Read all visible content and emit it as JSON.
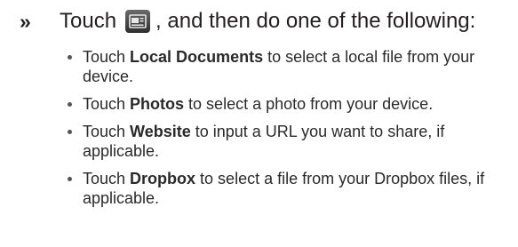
{
  "marker": "»",
  "instruction": {
    "before_icon": "Touch",
    "icon": "attach-file-icon",
    "after_icon": ", and then do one of the following:"
  },
  "options": [
    {
      "prefix": "Touch ",
      "bold": "Local Documents",
      "suffix": " to select a local file from your device."
    },
    {
      "prefix": "Touch ",
      "bold": "Photos",
      "suffix": " to select a photo from your device."
    },
    {
      "prefix": "Touch ",
      "bold": "Website",
      "suffix": " to input a URL you want to share, if applicable."
    },
    {
      "prefix": "Touch ",
      "bold": "Dropbox",
      "suffix": " to select a file from your Dropbox files, if applicable."
    }
  ]
}
